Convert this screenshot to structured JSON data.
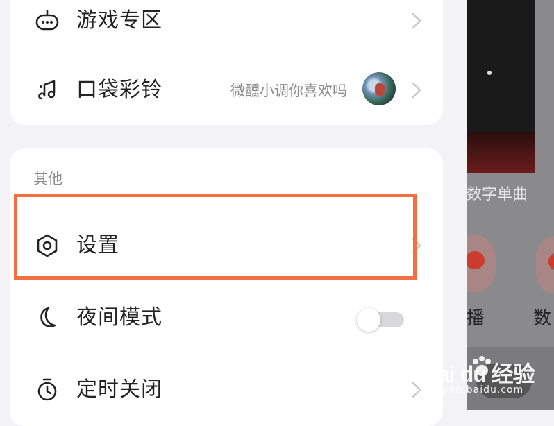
{
  "menu": {
    "top_items": [
      {
        "label": "游戏专区",
        "icon": "gamepad-icon"
      },
      {
        "label": "口袋彩铃",
        "icon": "music-note-icon",
        "subtext": "微醺小调你喜欢吗"
      }
    ],
    "section_title": "其他",
    "other_items": [
      {
        "label": "设置",
        "icon": "settings-hexagon-icon"
      },
      {
        "label": "夜间模式",
        "icon": "moon-icon",
        "toggle_on": false
      },
      {
        "label": "定时关闭",
        "icon": "timer-icon"
      }
    ]
  },
  "background_app": {
    "label_card": "数字单曲",
    "label_left": "播",
    "label_right": "数"
  },
  "watermark": {
    "main": "Bai du 经验",
    "sub": "jingyan.baidu.com"
  },
  "colors": {
    "highlight": "#f26f3e",
    "card_bg": "#ffffff",
    "page_bg": "#f3f3f5"
  }
}
